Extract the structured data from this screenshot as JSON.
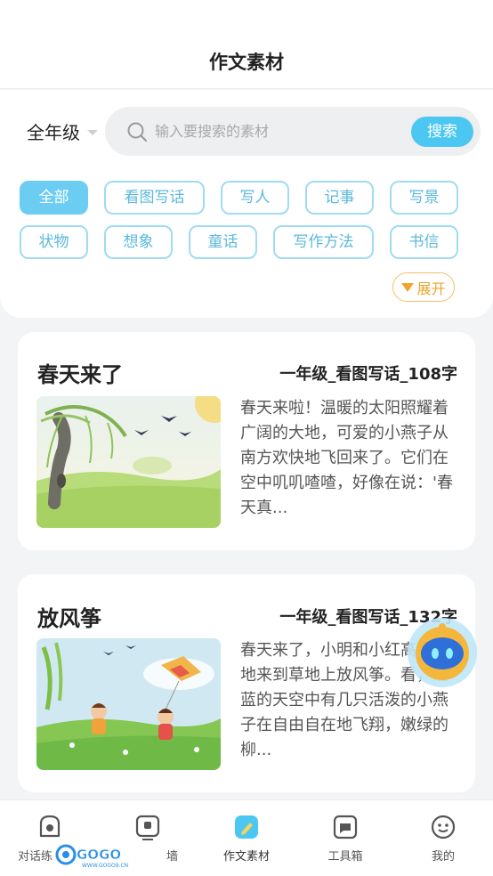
{
  "header": {
    "title": "作文素材"
  },
  "filter": {
    "grade": "全年级",
    "search_placeholder": "输入要搜索的素材",
    "search_button": "搜索",
    "tags": [
      "全部",
      "看图写话",
      "写人",
      "记事",
      "写景",
      "状物",
      "想象",
      "童话",
      "写作方法",
      "书信"
    ],
    "active_tag": "全部",
    "expand_label": "展开"
  },
  "articles": [
    {
      "title": "春天来了",
      "meta": "一年级_看图写话_108字",
      "excerpt": "春天来啦！温暖的太阳照耀着广阔的大地，可爱的小燕子从南方欢快地飞回来了。它们在空中叽叽喳喳，好像在说：'春天真..."
    },
    {
      "title": "放风筝",
      "meta": "一年级_看图写话_132字",
      "excerpt": "春天来了，小明和小红高采烈地来到草地上放风筝。看，湛蓝的天空中有几只活泼的小燕子在自由自在地飞翔，嫩绿的柳..."
    }
  ],
  "bottom_nav": [
    {
      "label": "对话练",
      "icon": "chat-practice-icon"
    },
    {
      "label": "墙",
      "icon": "wall-icon"
    },
    {
      "label": "作文素材",
      "icon": "essay-material-icon",
      "active": true
    },
    {
      "label": "工具箱",
      "icon": "toolbox-icon"
    },
    {
      "label": "我的",
      "icon": "profile-icon"
    }
  ],
  "watermark": {
    "brand": "GOGO手游网",
    "url": "WWW.GOGO9.CN"
  },
  "colors": {
    "accent": "#4cc7f2",
    "tag_border": "#9fdbf2",
    "expand": "#f0a52a"
  }
}
